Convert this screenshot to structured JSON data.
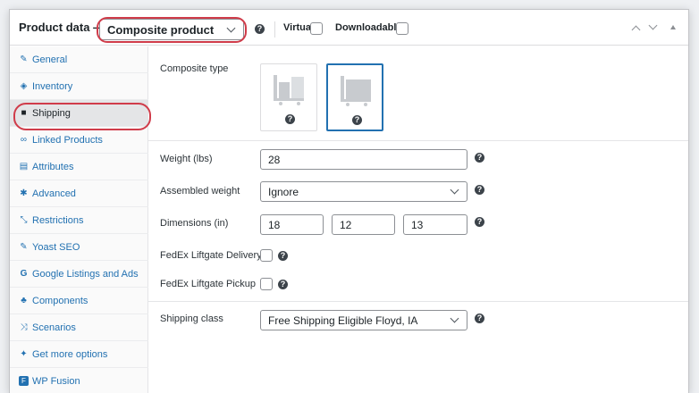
{
  "header": {
    "title": "Product data —",
    "product_type": "Composite product",
    "virtual_label": "Virtual:",
    "downloadable_label": "Downloadable:"
  },
  "sidebar": {
    "items": [
      {
        "label": "General",
        "icon": "wrench-icon"
      },
      {
        "label": "Inventory",
        "icon": "tag-icon"
      },
      {
        "label": "Shipping",
        "icon": "truck-icon",
        "active": true
      },
      {
        "label": "Linked Products",
        "icon": "link-icon"
      },
      {
        "label": "Attributes",
        "icon": "list-icon"
      },
      {
        "label": "Advanced",
        "icon": "gear-icon"
      },
      {
        "label": "Restrictions",
        "icon": "arrows-icon"
      },
      {
        "label": "Yoast SEO",
        "icon": "wrench-icon"
      },
      {
        "label": "Google Listings and Ads",
        "icon": "google-icon"
      },
      {
        "label": "Components",
        "icon": "components-icon"
      },
      {
        "label": "Scenarios",
        "icon": "shuffle-icon"
      },
      {
        "label": "Get more options",
        "icon": "plugin-icon"
      },
      {
        "label": "WP Fusion",
        "icon": "wp-fusion-icon"
      }
    ]
  },
  "main": {
    "composite_type_label": "Composite type",
    "weight_label": "Weight (lbs)",
    "weight_value": "28",
    "assembled_weight_label": "Assembled weight",
    "assembled_weight_value": "Ignore",
    "dimensions_label": "Dimensions (in)",
    "dim_length": "18",
    "dim_width": "12",
    "dim_height": "13",
    "liftgate_delivery_label": "FedEx Liftgate Delivery",
    "liftgate_pickup_label": "FedEx Liftgate Pickup",
    "shipping_class_label": "Shipping class",
    "shipping_class_value": "Free Shipping Eligible Floyd, IA"
  },
  "colors": {
    "accent": "#2271b1",
    "highlight": "#d03c4a"
  }
}
